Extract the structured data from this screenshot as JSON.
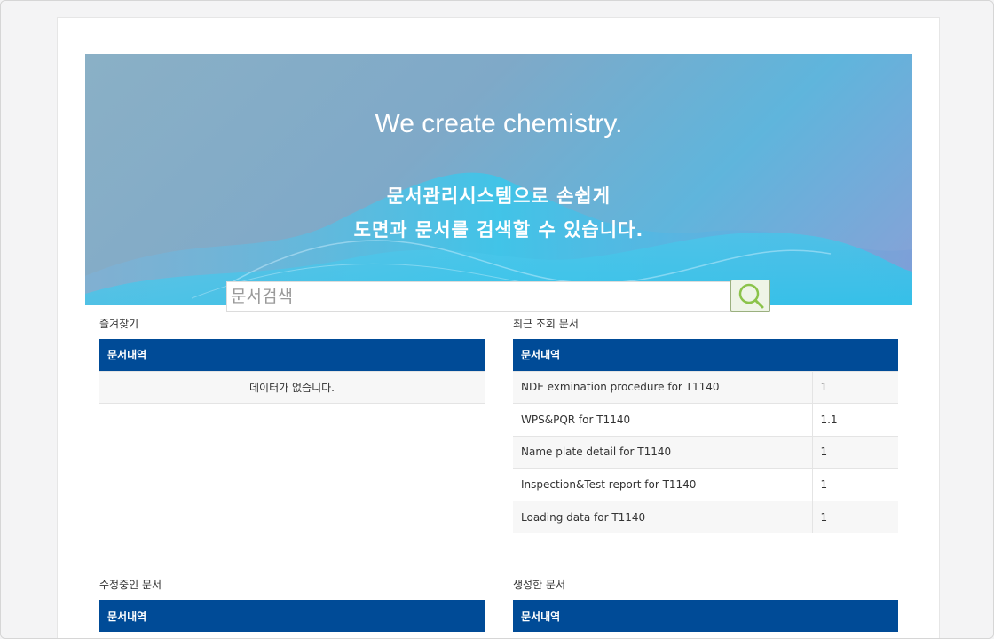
{
  "hero": {
    "title": "We create chemistry.",
    "line1": "문서관리시스템으로 손쉽게",
    "line2": "도면과 문서를 검색할 수 있습니다."
  },
  "search": {
    "placeholder": "문서검색",
    "value": ""
  },
  "favorites": {
    "label": "즐겨찾기",
    "header": "문서내역",
    "empty_text": "데이터가 없습니다."
  },
  "recent": {
    "label": "최근 조회 문서",
    "header": "문서내역",
    "rows": [
      {
        "name": "NDE exmination procedure for T1140",
        "version": "1"
      },
      {
        "name": "WPS&PQR for T1140",
        "version": "1.1"
      },
      {
        "name": "Name plate detail for T1140",
        "version": "1"
      },
      {
        "name": "Inspection&Test report for T1140",
        "version": "1"
      },
      {
        "name": "Loading data for T1140",
        "version": "1"
      }
    ]
  },
  "editing": {
    "label": "수정중인 문서",
    "header": "문서내역"
  },
  "created": {
    "label": "생성한 문서",
    "header": "문서내역"
  },
  "colors": {
    "header_blue": "#004b97",
    "search_accent": "#8bc34a"
  }
}
